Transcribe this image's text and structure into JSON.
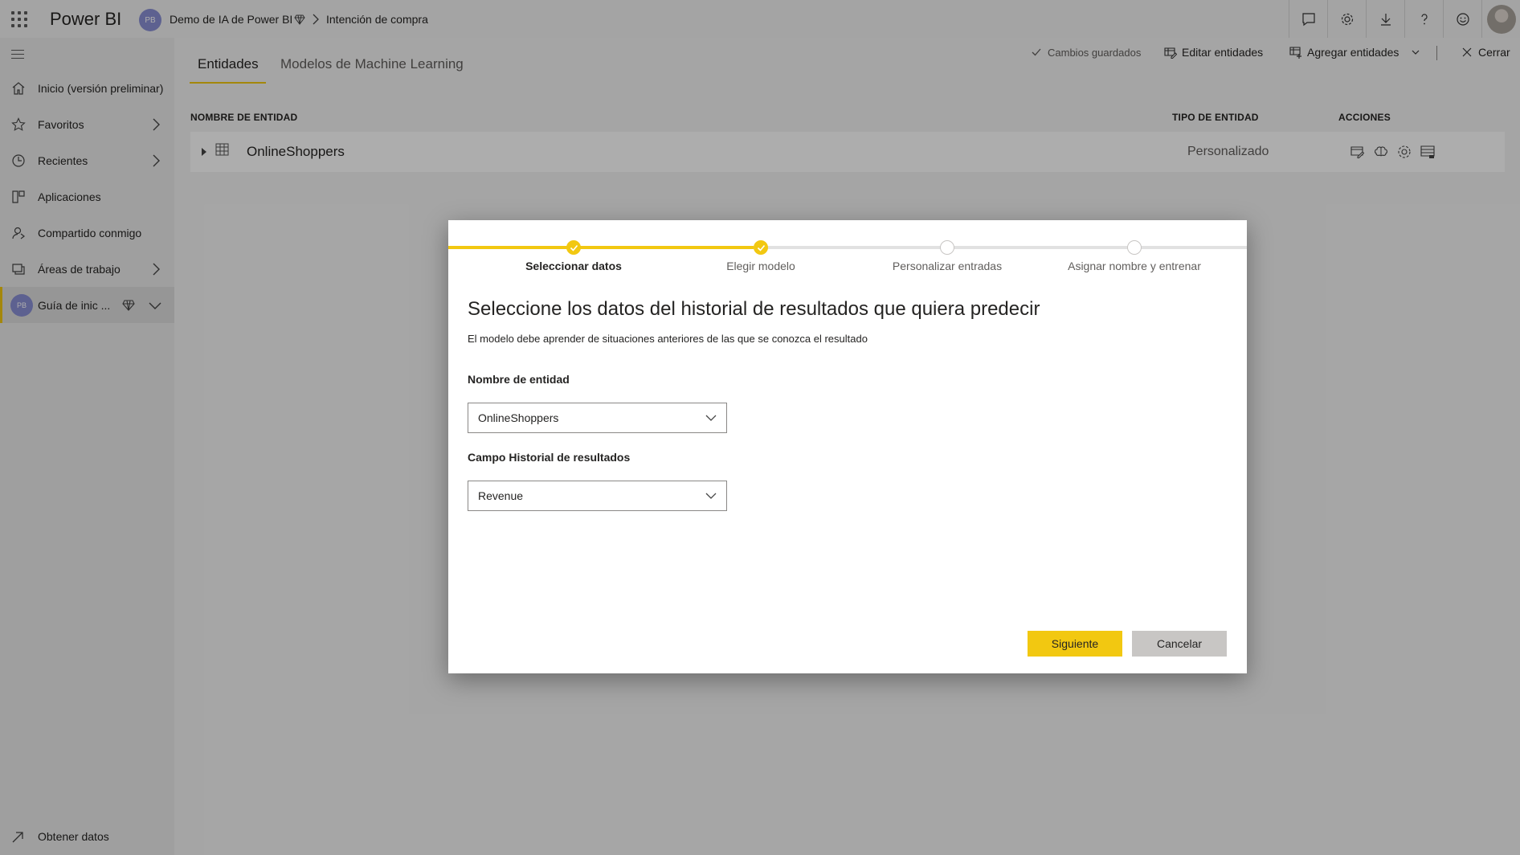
{
  "topbar": {
    "brand": "Power BI",
    "workspace_initials": "PB",
    "breadcrumb_workspace": "Demo de IA de Power BI",
    "breadcrumb_dataflow": "Intención de compra"
  },
  "sidebar": {
    "items": [
      {
        "label": "Inicio (versión preliminar)",
        "icon": "home-icon"
      },
      {
        "label": "Favoritos",
        "icon": "star-icon"
      },
      {
        "label": "Recientes",
        "icon": "clock-icon"
      },
      {
        "label": "Aplicaciones",
        "icon": "apps-icon"
      },
      {
        "label": "Compartido conmigo",
        "icon": "shared-icon"
      },
      {
        "label": "Áreas de trabajo",
        "icon": "workspaces-icon"
      },
      {
        "label": "Guía de inic ...",
        "icon": "diamond-icon",
        "initials": "PB"
      }
    ],
    "get_data": "Obtener datos"
  },
  "tabs": {
    "entities": "Entidades",
    "ml_models": "Modelos de Machine Learning"
  },
  "commands": {
    "saved": "Cambios guardados",
    "edit_entities": "Editar entidades",
    "add_entities": "Agregar entidades",
    "close": "Cerrar"
  },
  "table": {
    "headers": {
      "name": "NOMBRE DE ENTIDAD",
      "type": "TIPO DE ENTIDAD",
      "actions": "ACCIONES"
    },
    "rows": [
      {
        "name": "OnlineShoppers",
        "type": "Personalizado"
      }
    ]
  },
  "dialog": {
    "steps": [
      {
        "label": "Seleccionar datos",
        "state": "done",
        "current": true
      },
      {
        "label": "Elegir modelo",
        "state": "done",
        "current": false
      },
      {
        "label": "Personalizar entradas",
        "state": "pending",
        "current": false
      },
      {
        "label": "Asignar nombre y entrenar",
        "state": "pending",
        "current": false
      }
    ],
    "title": "Seleccione los datos del historial de resultados que quiera predecir",
    "subtitle": "El modelo debe aprender de situaciones anteriores de las que se conozca el resultado",
    "entity_label": "Nombre de entidad",
    "entity_value": "OnlineShoppers",
    "outcome_label": "Campo Historial de resultados",
    "outcome_value": "Revenue",
    "next_button": "Siguiente",
    "cancel_button": "Cancelar"
  },
  "colors": {
    "accent": "#f2c811",
    "avatar": "#8a8fd4"
  }
}
